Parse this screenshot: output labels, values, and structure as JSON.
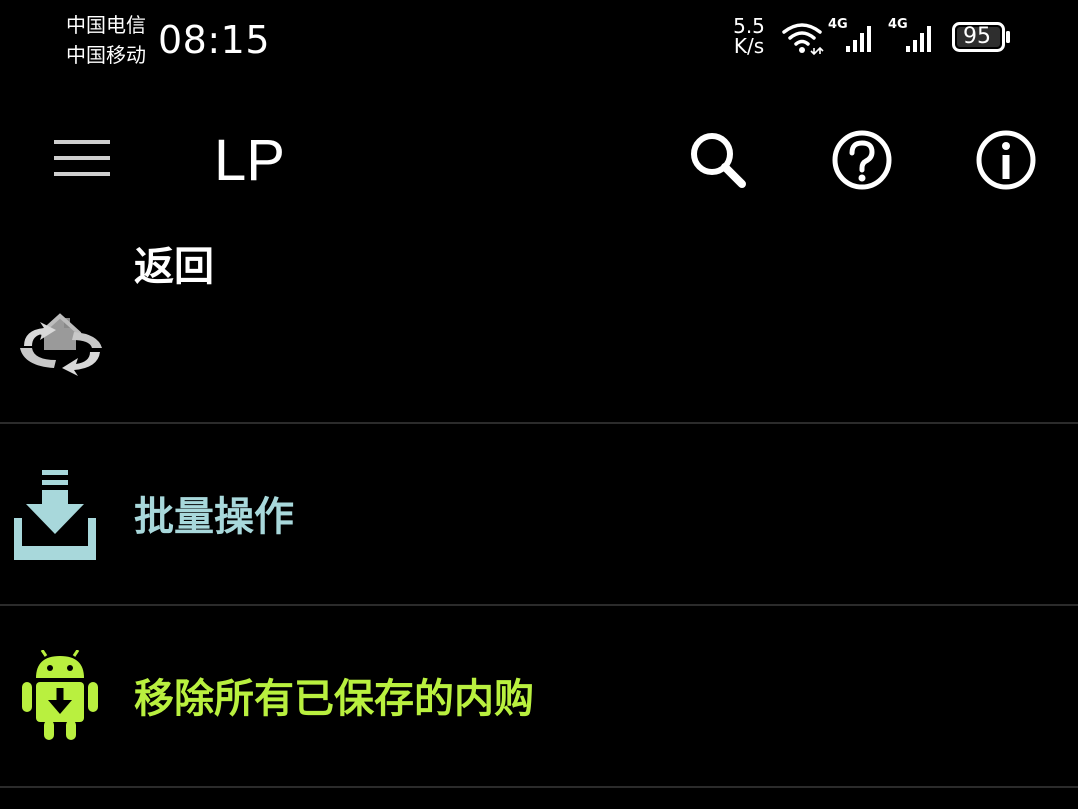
{
  "status_bar": {
    "carrier_1": "中国电信",
    "carrier_2": "中国移动",
    "time": "08:15",
    "net_speed_value": "5.5",
    "net_speed_unit": "K/s",
    "signal_1_label": "4G",
    "signal_2_label": "4G",
    "battery_level": "95",
    "icons": [
      "wifi-icon",
      "signal-4g-icon",
      "signal-4g-icon",
      "battery-icon"
    ]
  },
  "app_bar": {
    "title": "LP",
    "icons": [
      "menu-icon",
      "search-icon",
      "help-icon",
      "info-icon"
    ]
  },
  "list": {
    "items": [
      {
        "label": "返回",
        "icon": "home-refresh-icon",
        "color": "#e8e8e8"
      },
      {
        "label": "批量操作",
        "icon": "download-tray-icon",
        "color": "#a8d8db"
      },
      {
        "label": "移除所有已保存的内购",
        "icon": "android-download-icon",
        "color": "#b9f03f"
      }
    ]
  },
  "colors": {
    "background": "#000000",
    "divider": "#2b2b2b",
    "batch_accent": "#a8d8db",
    "android_green": "#b9f03f"
  }
}
